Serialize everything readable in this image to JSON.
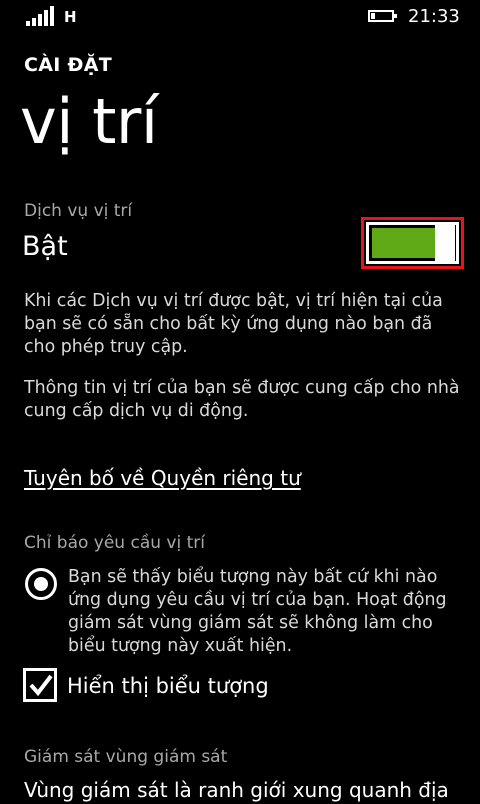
{
  "status_bar": {
    "network_type": "H",
    "clock": "21:33",
    "battery_level_fraction": 0.2,
    "signal_bars": 5,
    "icons": [
      "signal-strength-icon",
      "battery-icon"
    ]
  },
  "header": {
    "section": "CÀI ĐẶT",
    "title": "vị trí"
  },
  "location_service": {
    "label": "Dịch vụ vị trí",
    "value": "Bật",
    "toggle_on": true,
    "toggle_color": "#60a917",
    "highlight_color": "#e8141c"
  },
  "description": {
    "para1": "Khi các Dịch vụ vị trí được bật, vị trí hiện tại của bạn sẽ có sẵn cho bất kỳ ứng dụng nào bạn đã cho phép truy cập.",
    "para2": "Thông tin vị trí của bạn sẽ được cung cấp cho nhà cung cấp dịch vụ di động."
  },
  "privacy_link": "Tuyên bố về Quyền riêng tư",
  "indicator": {
    "label": "Chỉ báo yêu cầu vị trí",
    "radio_text": "Bạn sẽ thấy biểu tượng này bất cứ khi nào ứng dụng yêu cầu vị trí của bạn. Hoạt động giám sát vùng giám sát sẽ không làm cho biểu tượng này xuất hiện.",
    "show_icon_label": "Hiển thị biểu tượng",
    "show_icon_checked": true
  },
  "geofence": {
    "label": "Giám sát vùng giám sát",
    "text": "Vùng giám sát là ranh giới xung quanh địa"
  }
}
